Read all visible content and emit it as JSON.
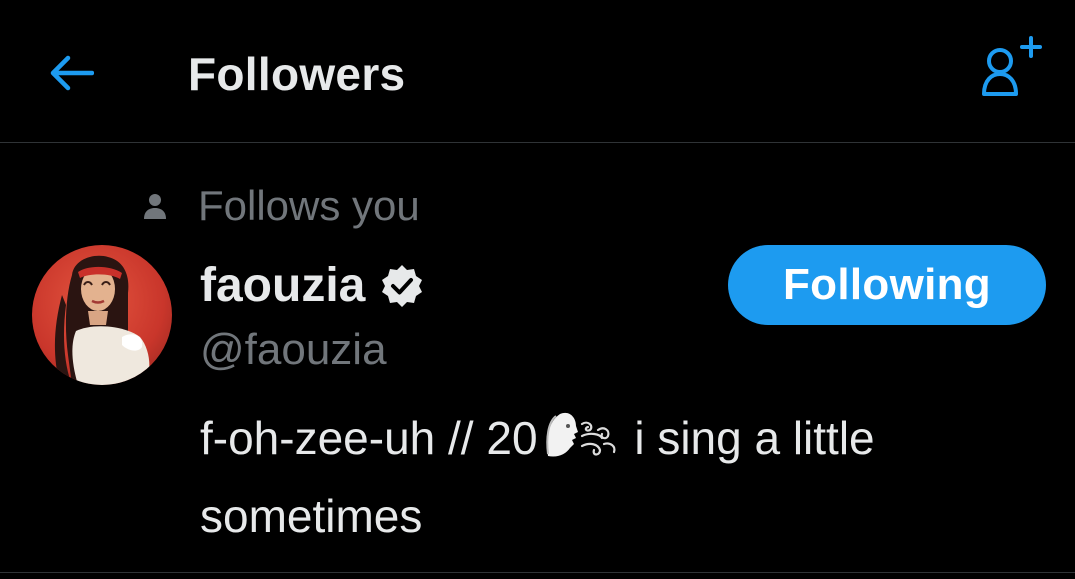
{
  "header": {
    "title": "Followers",
    "back_icon": "arrow-left-icon",
    "add_user_icon": "person-plus-icon"
  },
  "user_card": {
    "follows_you_label": "Follows you",
    "display_name": "faouzia",
    "verified": true,
    "handle": "@faouzia",
    "follow_button_label": "Following",
    "bio_before_emoji": "f-oh-zee-uh // 20",
    "bio_emoji_icon": "face-blowing-wind-emoji",
    "bio_after_emoji": "i sing a little sometimes"
  },
  "colors": {
    "accent": "#1d9bf0",
    "background": "#000000",
    "primary_text": "#e7e9ea",
    "secondary_text": "#71767b",
    "divider": "#2f3336"
  }
}
